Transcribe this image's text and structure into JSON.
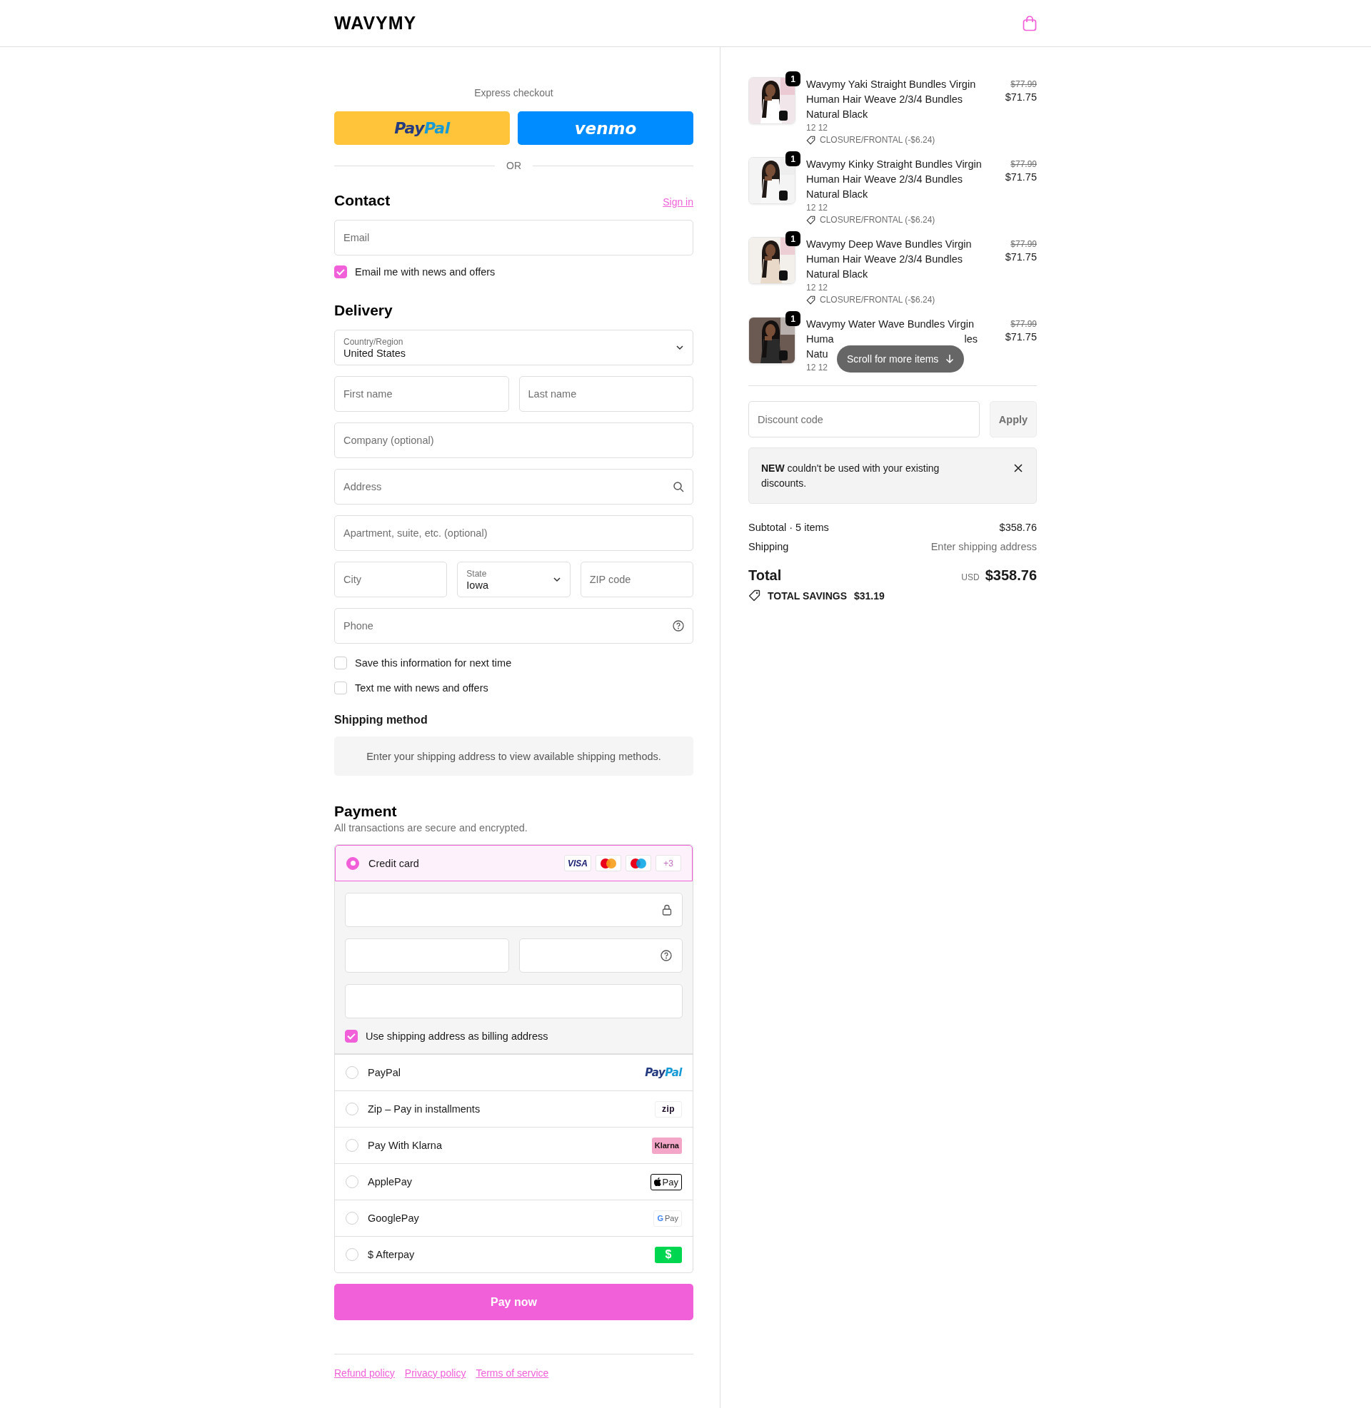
{
  "header": {
    "logo": "WAVYMY"
  },
  "express": {
    "label": "Express checkout",
    "buttons": [
      {
        "kind": "paypal",
        "parts": [
          "Pay",
          "Pal"
        ]
      },
      {
        "kind": "venmo",
        "parts": [
          "venmo"
        ]
      }
    ],
    "divider": "OR"
  },
  "contact": {
    "title": "Contact",
    "sign_in": "Sign in",
    "email": {
      "placeholder": "Email"
    },
    "news": {
      "label": "Email me with news and offers",
      "checked": true
    }
  },
  "delivery": {
    "title": "Delivery",
    "rows": [
      [
        {
          "kind": "select",
          "label": "Country/Region",
          "value": "United States"
        }
      ],
      [
        {
          "kind": "text",
          "placeholder": "First name"
        },
        {
          "kind": "text",
          "placeholder": "Last name"
        }
      ],
      [
        {
          "kind": "text",
          "placeholder": "Company (optional)"
        }
      ],
      [
        {
          "kind": "search",
          "placeholder": "Address"
        }
      ],
      [
        {
          "kind": "text",
          "placeholder": "Apartment, suite, etc. (optional)"
        }
      ],
      [
        {
          "kind": "text",
          "placeholder": "City"
        },
        {
          "kind": "select",
          "label": "State",
          "value": "Iowa"
        },
        {
          "kind": "text",
          "placeholder": "ZIP code"
        }
      ],
      [
        {
          "kind": "help",
          "placeholder": "Phone"
        }
      ]
    ],
    "options": [
      {
        "label": "Save this information for next time",
        "checked": false
      },
      {
        "label": "Text me with news and offers",
        "checked": false
      }
    ]
  },
  "shipping": {
    "title": "Shipping method",
    "message": "Enter your shipping address to view available shipping methods."
  },
  "payment": {
    "title": "Payment",
    "subtitle": "All transactions are secure and encrypted.",
    "methods": [
      {
        "kind": "card",
        "label": "Credit card",
        "selected": true,
        "brands": [
          {
            "kind": "visa",
            "text": "VISA"
          },
          {
            "kind": "mastercard"
          },
          {
            "kind": "maestro"
          },
          {
            "kind": "more",
            "text": "+3"
          }
        ]
      },
      {
        "kind": "paypal",
        "label": "PayPal",
        "selected": false,
        "logo": [
          "Pay",
          "Pal"
        ]
      },
      {
        "kind": "zip",
        "label": "Zip – Pay in installments",
        "selected": false,
        "logo": [
          "zip"
        ]
      },
      {
        "kind": "klarna",
        "label": "Pay With Klarna",
        "selected": false,
        "logo": [
          "Klarna"
        ]
      },
      {
        "kind": "applepay",
        "label": "ApplePay",
        "selected": false,
        "logo": [
          "Pay"
        ]
      },
      {
        "kind": "googlepay",
        "label": "GooglePay",
        "selected": false,
        "logo": [
          "G",
          "Pay"
        ]
      },
      {
        "kind": "afterpay",
        "label": "$ Afterpay",
        "selected": false,
        "logo": [
          "$"
        ]
      }
    ],
    "billing": {
      "label": "Use shipping address as billing address",
      "checked": true
    },
    "pay_button": "Pay now"
  },
  "footer": {
    "links": [
      "Refund policy",
      "Privacy policy",
      "Terms of service"
    ]
  },
  "summary": {
    "items": [
      {
        "title": "Wavymy Yaki Straight Bundles Virgin Human Hair Weave 2/3/4 Bundles Natural Black",
        "quantity": "1",
        "compare_price": "$77.99",
        "price": "$71.75",
        "variant": "12 12",
        "discount": "CLOSURE/FRONTAL (-$6.24)"
      },
      {
        "title": "Wavymy Kinky Straight Bundles Virgin Human Hair Weave 2/3/4 Bundles Natural Black",
        "quantity": "1",
        "compare_price": "$77.99",
        "price": "$71.75",
        "variant": "12 12",
        "discount": "CLOSURE/FRONTAL (-$6.24)"
      },
      {
        "title": "Wavymy Deep Wave Bundles Virgin Human Hair Weave 2/3/4 Bundles Natural Black",
        "quantity": "1",
        "compare_price": "$77.99",
        "price": "$71.75",
        "variant": "12 12",
        "discount": "CLOSURE/FRONTAL (-$6.24)"
      },
      {
        "title_lines": [
          [
            "Wavymy Water Wave Bundles Virgin"
          ],
          [
            "Huma",
            "les"
          ],
          [
            "Natu"
          ]
        ],
        "quantity": "1",
        "compare_price": "$77.99",
        "price": "$71.75",
        "variant": "12 12"
      }
    ],
    "scroll_hint": "Scroll for more items",
    "discount": {
      "placeholder": "Discount code",
      "button": "Apply"
    },
    "notice": "**NEW** couldn't be used with your existing discounts.",
    "subtotal": {
      "label": "Subtotal · 5 items",
      "value": "$358.76"
    },
    "shipping": {
      "label": "Shipping",
      "value": "Enter shipping address"
    },
    "total": {
      "label": "Total",
      "currency": "USD",
      "value": "$358.76"
    },
    "savings": {
      "label": "TOTAL SAVINGS",
      "value": "$31.19"
    }
  }
}
